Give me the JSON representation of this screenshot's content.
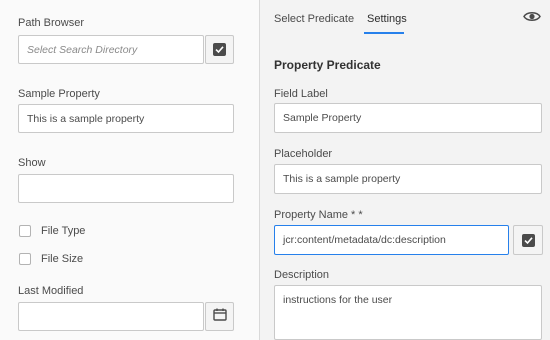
{
  "left_panel": {
    "path_browser": {
      "label": "Path Browser",
      "placeholder": "Select Search Directory"
    },
    "sample_property": {
      "label": "Sample Property",
      "value": "This is a sample property"
    },
    "show": {
      "label": "Show",
      "value": ""
    },
    "checkboxes": [
      {
        "label": "File Type",
        "checked": false
      },
      {
        "label": "File Size",
        "checked": false
      }
    ],
    "last_modified": {
      "label": "Last Modified",
      "value": ""
    }
  },
  "right_panel": {
    "tabs": [
      {
        "label": "Select Predicate",
        "active": false
      },
      {
        "label": "Settings",
        "active": true
      }
    ],
    "preview_icon": "eye-icon",
    "section_title": "Property Predicate",
    "field_label": {
      "label": "Field Label",
      "value": "Sample Property"
    },
    "placeholder": {
      "label": "Placeholder",
      "value": "This is a sample property"
    },
    "property_name": {
      "label": "Property Name * *",
      "value": "jcr:content/metadata/dc:description"
    },
    "description": {
      "label": "Description",
      "value": "instructions for the user"
    }
  },
  "colors": {
    "accent": "#2680eb",
    "icon": "#4b4b4b"
  }
}
